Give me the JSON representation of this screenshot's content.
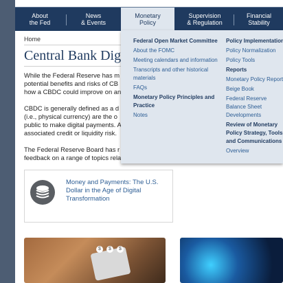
{
  "nav": {
    "items": [
      {
        "line1": "About",
        "line2": "the Fed"
      },
      {
        "line1": "News",
        "line2": "& Events"
      },
      {
        "line1": "Monetary",
        "line2": "Policy"
      },
      {
        "line1": "Supervision",
        "line2": "& Regulation"
      },
      {
        "line1": "Financial",
        "line2": "Stability"
      }
    ],
    "active": "Monetary Policy"
  },
  "breadcrumb": {
    "home": "Home"
  },
  "page": {
    "title": "Central Bank Digital Currency"
  },
  "body": {
    "p1": [
      "While the Federal Reserve has m",
      "potential benefits and risks of CB",
      "how a CBDC could improve on an"
    ],
    "p2": [
      "CBDC is generally defined as a d",
      "(i.e., physical currency) are the o",
      "public to make digital payments. A",
      "associated credit or liquidity risk."
    ],
    "p3": [
      "The Federal Reserve Board has r",
      "feedback on a range of topics rela"
    ]
  },
  "card": {
    "icon": "stack-coins-icon",
    "link": "Money and Payments: The U.S. Dollar in the Age of Digital Transformation"
  },
  "dropdown": {
    "col1": [
      {
        "text": "Federal Open Market Committee",
        "head": true
      },
      {
        "text": "About the FOMC",
        "head": false
      },
      {
        "text": "Meeting calendars and information",
        "head": false
      },
      {
        "text": "Transcripts and other historical materials",
        "head": false
      },
      {
        "text": "FAQs",
        "head": false
      },
      {
        "text": "Monetary Policy Principles and Practice",
        "head": true
      },
      {
        "text": "Notes",
        "head": false
      }
    ],
    "col2": [
      {
        "text": "Policy Implementation",
        "head": true
      },
      {
        "text": "Policy Normalization",
        "head": false
      },
      {
        "text": "Policy Tools",
        "head": false
      },
      {
        "text": "Reports",
        "head": true
      },
      {
        "text": "Monetary Policy Report",
        "head": false
      },
      {
        "text": "Beige Book",
        "head": false
      },
      {
        "text": "Federal Reserve Balance Sheet Developments",
        "head": false
      },
      {
        "text": "Review of Monetary Policy Strategy, Tools, and Communications",
        "head": true
      },
      {
        "text": "Overview",
        "head": false
      }
    ]
  },
  "colors": {
    "navy": "#1f3a5f",
    "link": "#2c5d94",
    "dropdown_bg": "#dfe6ee"
  }
}
